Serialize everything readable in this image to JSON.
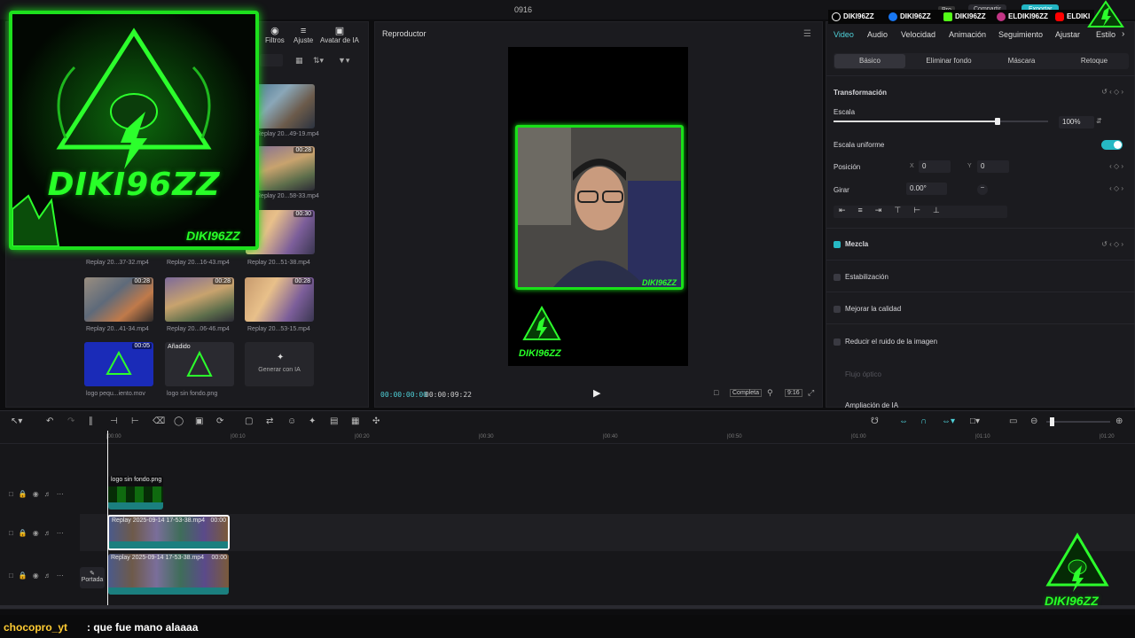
{
  "window": {
    "title": "0916"
  },
  "colors": {
    "accent": "#4fd1d9",
    "green": "#1de01d",
    "bg": "#1b1b1f"
  },
  "media": {
    "toolbar": [
      {
        "icon": "filters-icon",
        "label": "Filtros"
      },
      {
        "icon": "adjust-icon",
        "label": "Ajuste"
      },
      {
        "icon": "ai-avatar-icon",
        "label": "Avatar de IA"
      }
    ],
    "items": [
      {
        "name": "Replay 20...49-19.mp4",
        "dur": ""
      },
      {
        "name": "Replay 20...58-33.mp4",
        "dur": "00:28"
      },
      {
        "name": "Replay 20...37-32.mp4",
        "dur": ""
      },
      {
        "name": "Replay 20...16-43.mp4",
        "dur": ""
      },
      {
        "name": "Replay 20...51-38.mp4",
        "dur": "00:30"
      },
      {
        "name": "Replay 20...41-34.mp4",
        "dur": "00:28"
      },
      {
        "name": "Replay 20...06-46.mp4",
        "dur": "00:28"
      },
      {
        "name": "Replay 20...53-15.mp4",
        "dur": "00:28"
      },
      {
        "name": "logo pequ...iento.mov",
        "dur": "00:05"
      },
      {
        "name": "logo sin fondo.png",
        "dur": "",
        "badge": "Añadido"
      }
    ],
    "add_partial": "lido",
    "generate_ai": "Generar con IA"
  },
  "overlay": {
    "brand": "DIKI96ZZ"
  },
  "player": {
    "title": "Reproductor",
    "current_time": "00:00:00:00",
    "total_time": "00:00:09:22",
    "fit_label": "Completa",
    "ratio": "9:16",
    "cam_tag": "DIKI96ZZ"
  },
  "props": {
    "tabs": [
      "Video",
      "Audio",
      "Velocidad",
      "Animación",
      "Seguimiento",
      "Ajustar",
      "Estilo"
    ],
    "subtabs": [
      "Básico",
      "Eliminar fondo",
      "Máscara",
      "Retoque"
    ],
    "transform_label": "Transformación",
    "scale_label": "Escala",
    "scale_value": "100%",
    "scale_level": 0.9,
    "uniform_label": "Escala uniforme",
    "position_label": "Posición",
    "pos_x_label": "X",
    "pos_x": "0",
    "pos_y_label": "Y",
    "pos_y": "0",
    "rotate_label": "Girar",
    "rotate_value": "0.00°",
    "blend_label": "Mezcla",
    "stabilize_label": "Estabilización",
    "quality_label": "Mejorar la calidad",
    "noise_label": "Reducir el ruido de la imagen",
    "optical_label": "Flujo óptico",
    "ai_expand_label": "Ampliación de IA"
  },
  "social": [
    {
      "icon": "tiktok-icon",
      "handle": "DIKI96ZZ",
      "color": "#000000"
    },
    {
      "icon": "facebook-icon",
      "handle": "DIKI96ZZ",
      "color": "#1877f2"
    },
    {
      "icon": "kick-icon",
      "handle": "DIKI96ZZ",
      "color": "#53fc18"
    },
    {
      "icon": "instagram-icon",
      "handle": "ELDIKI96ZZ",
      "color": "#c13584"
    },
    {
      "icon": "youtube-icon",
      "handle": "ELDIKI",
      "color": "#ff0000"
    }
  ],
  "topbar": {
    "share": "Compartir",
    "pro": "Pro",
    "export": "Exportar"
  },
  "timeline": {
    "ruler": [
      "00:00",
      "00:10",
      "00:20",
      "00:30",
      "00:40",
      "00:50",
      "01:00",
      "01:10",
      "01:20"
    ],
    "tracks": [
      {
        "label": "logo sin fondo.png",
        "dur": ""
      },
      {
        "label": "Replay 2025-09-14 17-53-38.mp4",
        "dur": "00:00"
      },
      {
        "label": "Replay 2025-09-14 17-53-38.mp4",
        "dur": "00:00"
      }
    ],
    "cover_label": "Portada"
  },
  "chat": {
    "user": "chocopro_yt",
    "message": ": que fue mano alaaaa"
  }
}
